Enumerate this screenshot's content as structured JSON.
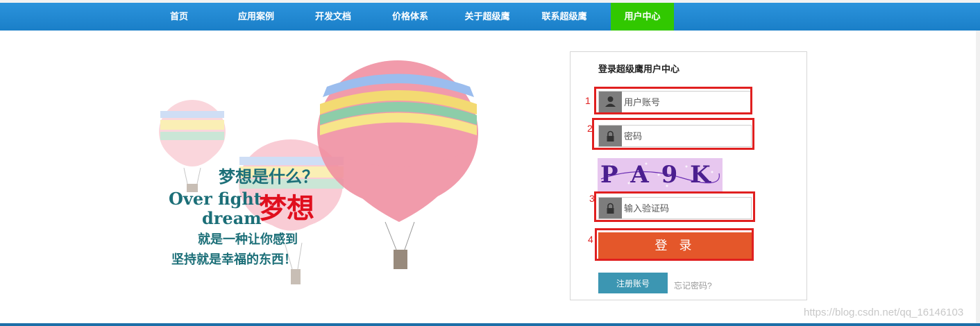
{
  "nav": {
    "items": [
      {
        "label": "首页"
      },
      {
        "label": "应用案例"
      },
      {
        "label": "开发文档"
      },
      {
        "label": "价格体系"
      },
      {
        "label": "关于超级鹰"
      },
      {
        "label": "联系超级鹰"
      },
      {
        "label": "用户中心",
        "active": true
      }
    ]
  },
  "hero": {
    "line1": "梦想是什么？",
    "line2a": "Over fight",
    "line2b": "dream",
    "highlight": "梦想",
    "line3": "就是一种让你感到",
    "line4": "坚持就是幸福的东西！"
  },
  "login": {
    "title": "登录超级鹰用户中心",
    "username_placeholder": "用户账号",
    "password_placeholder": "密码",
    "captcha_text": "P A 9 K",
    "captcha_placeholder": "输入验证码",
    "login_label": "登 录",
    "register_label": "注册账号",
    "forgot_label": "忘记密码?",
    "annotations": [
      "1",
      "2",
      "3",
      "4"
    ]
  },
  "watermark": "https://blog.csdn.net/qq_16146103",
  "colors": {
    "nav": "#1a7fc8",
    "nav_active": "#31c800",
    "login_button": "#e4572a",
    "register_button": "#3c96b2",
    "annotation": "#e02020"
  }
}
